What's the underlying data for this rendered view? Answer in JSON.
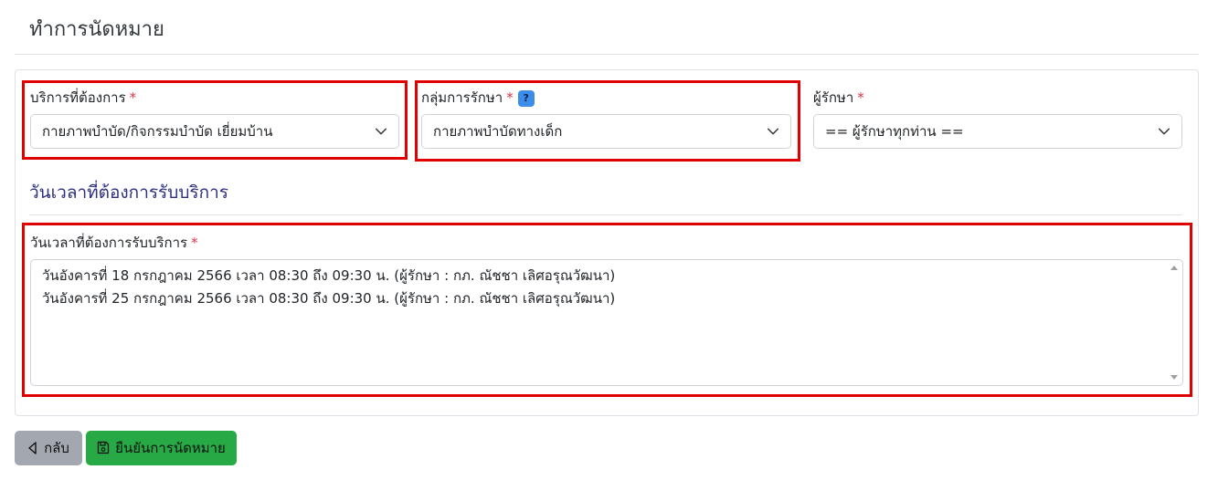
{
  "page": {
    "title": "ทำการนัดหมาย"
  },
  "form": {
    "service": {
      "label": "บริการที่ต้องการ",
      "required_mark": "*",
      "value": "กายภาพบำบัด/กิจกรรมบำบัด เยี่ยมบ้าน"
    },
    "group": {
      "label": "กลุ่มการรักษา",
      "required_mark": "*",
      "help_badge": "?",
      "value": "กายภาพบำบัดทางเด็ก"
    },
    "therapist": {
      "label": "ผู้รักษา",
      "required_mark": "*",
      "value": "== ผู้รักษาทุกท่าน =="
    }
  },
  "schedule_section": {
    "heading": "วันเวลาที่ต้องการรับบริการ",
    "field_label": "วันเวลาที่ต้องการรับบริการ",
    "required_mark": "*",
    "lines": [
      "วันอังคารที่ 18 กรกฎาคม 2566 เวลา 08:30 ถึง 09:30 น. (ผู้รักษา : กภ. ณัชชา เลิศอรุณวัฒนา)",
      "วันอังคารที่ 25 กรกฎาคม 2566 เวลา 08:30 ถึง 09:30 น. (ผู้รักษา : กภ. ณัชชา เลิศอรุณวัฒนา)"
    ]
  },
  "buttons": {
    "back_label": "กลับ",
    "confirm_label": "ยืนยันการนัดหมาย"
  },
  "colors": {
    "highlight": "#e00000",
    "required": "#dc3545",
    "back_button": "#a3a8b0",
    "confirm_button": "#27a946",
    "section_heading": "#2c2f80"
  },
  "icons": {
    "select_arrow": "chevron-down-icon",
    "back": "caret-left-icon",
    "confirm": "save-icon",
    "help": "question-icon"
  }
}
